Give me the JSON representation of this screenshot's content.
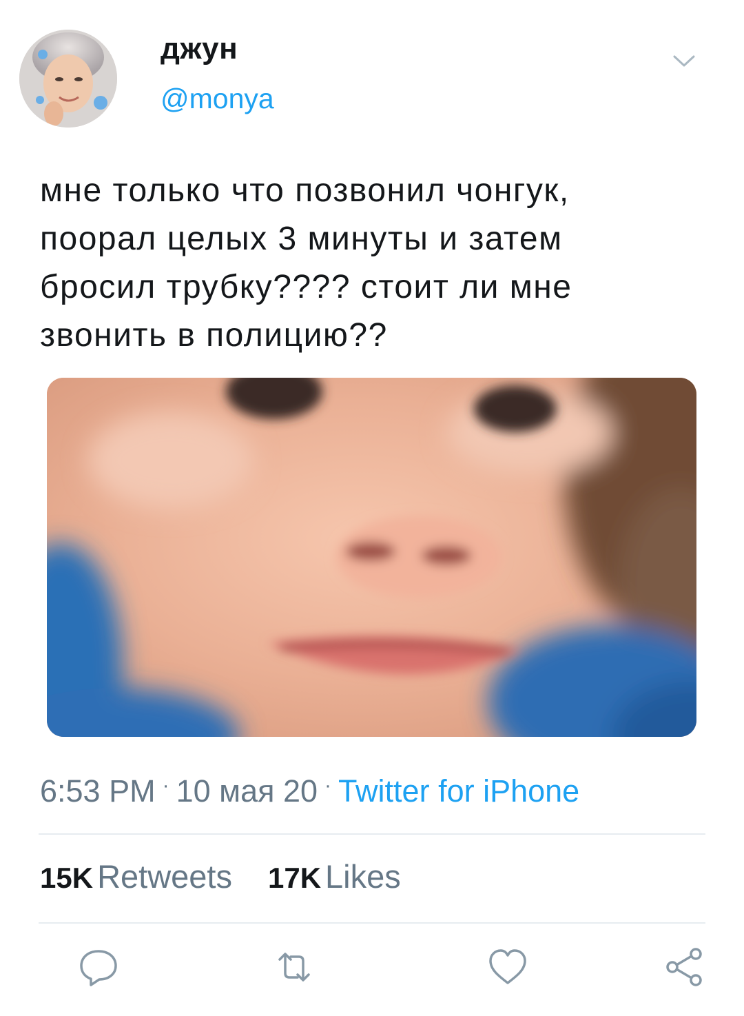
{
  "tweet": {
    "author": {
      "display_name": "джун",
      "handle": "@monya",
      "avatar_icon": "profile-photo"
    },
    "text": "мне только что позвонил чонгук,\nпоорал целых 3 минуты и затем\nбросил трубку???? стоит ли мне\nзвонить в полицию??",
    "media": {
      "type": "photo"
    },
    "meta": {
      "time": "6:53 PM",
      "separator": "·",
      "date": "10 мая 20",
      "source": "Twitter for iPhone"
    },
    "stats": {
      "retweets_count": "15K",
      "retweets_label": "Retweets",
      "likes_count": "17K",
      "likes_label": "Likes"
    },
    "actions": {
      "reply_icon": "reply-icon",
      "retweet_icon": "retweet-icon",
      "like_icon": "heart-icon",
      "share_icon": "share-icon"
    }
  },
  "colors": {
    "accent": "#1da1f2",
    "secondary_text": "#657786",
    "primary_text": "#14171a",
    "icon": "#8899a6",
    "divider": "#e6ecf0"
  }
}
